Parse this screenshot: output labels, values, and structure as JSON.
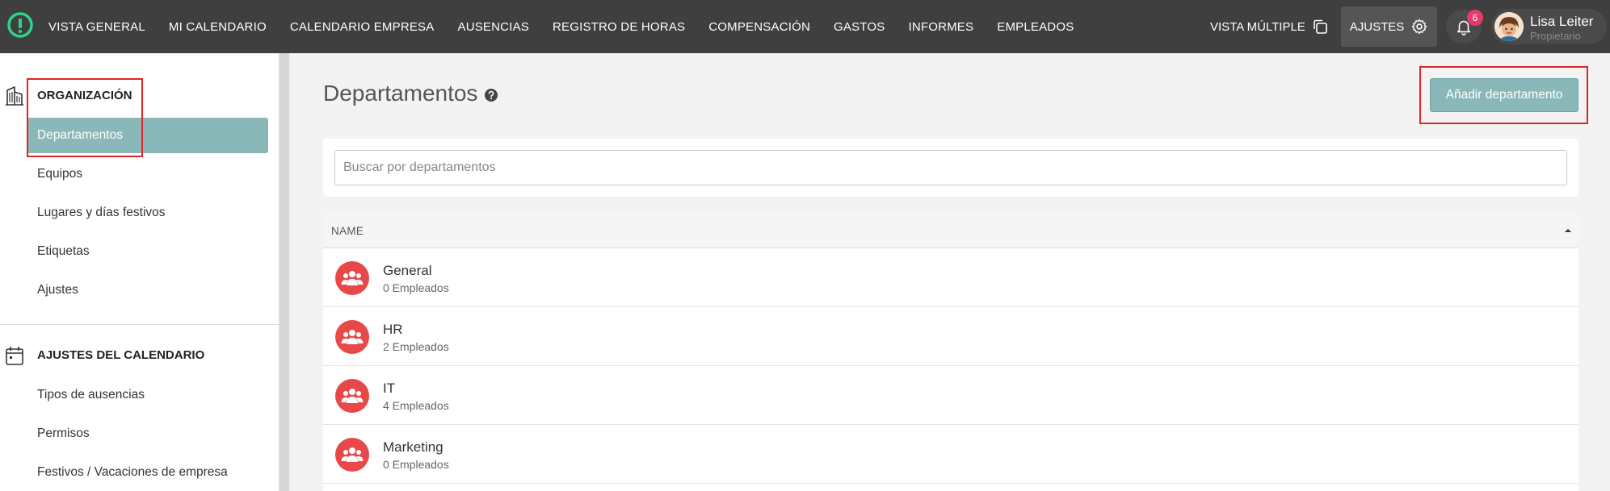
{
  "colors": {
    "topbar": "#3f3f3f",
    "accent": "#8ab8b8",
    "logo": "#2ed38a",
    "badge": "#e8396b",
    "dept_icon": "#e84848",
    "highlight_box": "#e02424"
  },
  "topbar": {
    "nav": [
      "VISTA GENERAL",
      "MI CALENDARIO",
      "CALENDARIO EMPRESA",
      "AUSENCIAS",
      "REGISTRO DE HORAS",
      "COMPENSACIÓN",
      "GASTOS",
      "INFORMES",
      "EMPLEADOS"
    ],
    "multi_view_label": "VISTA MÚLTIPLE",
    "settings_label": "AJUSTES",
    "notification_count": "6",
    "user_name": "Lisa Leiter",
    "user_role": "Propietario"
  },
  "sidebar": {
    "sections": [
      {
        "title": "ORGANIZACIÓN",
        "icon": "building-icon",
        "items": [
          "Departamentos",
          "Equipos",
          "Lugares y días festivos",
          "Etiquetas",
          "Ajustes"
        ]
      },
      {
        "title": "AJUSTES DEL CALENDARIO",
        "icon": "calendar-icon",
        "items": [
          "Tipos de ausencias",
          "Permisos",
          "Festivos / Vacaciones de empresa"
        ]
      }
    ],
    "active_item": "Departamentos"
  },
  "main": {
    "title": "Departamentos",
    "add_button": "Añadir departamento",
    "search_placeholder": "Buscar por departamentos",
    "table": {
      "column": "NAME",
      "rows": [
        {
          "name": "General",
          "count": "0 Empleados"
        },
        {
          "name": "HR",
          "count": "2 Empleados"
        },
        {
          "name": "IT",
          "count": "4 Empleados"
        },
        {
          "name": "Marketing",
          "count": "0 Empleados"
        }
      ]
    }
  }
}
